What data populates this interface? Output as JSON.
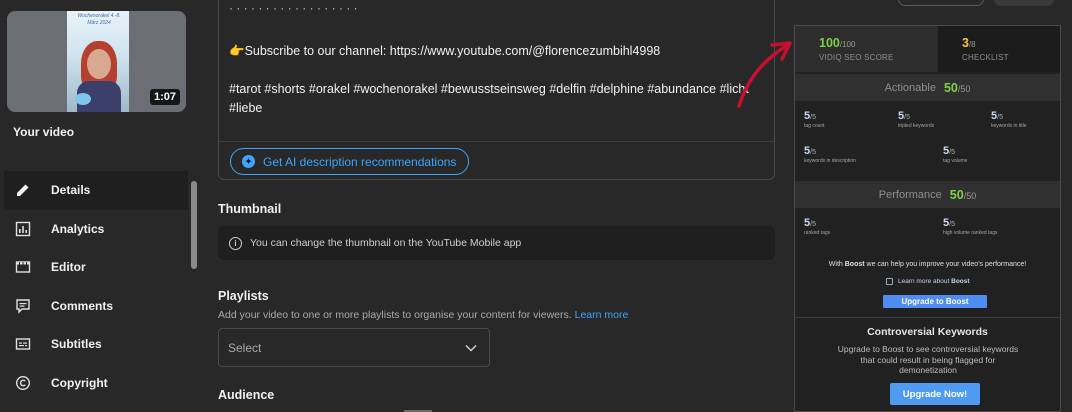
{
  "video": {
    "thumbnail_overlay_text": "Wochenorakel 4.-8. März 2024",
    "duration": "1:07",
    "label": "Your video"
  },
  "sidebar": {
    "items": [
      {
        "label": "Details",
        "icon": "pencil-icon",
        "active": true
      },
      {
        "label": "Analytics",
        "icon": "analytics-icon",
        "active": false
      },
      {
        "label": "Editor",
        "icon": "film-editor-icon",
        "active": false
      },
      {
        "label": "Comments",
        "icon": "comments-icon",
        "active": false
      },
      {
        "label": "Subtitles",
        "icon": "subtitles-icon",
        "active": false
      },
      {
        "label": "Copyright",
        "icon": "copyright-icon",
        "active": false
      }
    ]
  },
  "description": {
    "top_partial": "· · · · · · · · · · · · · · · · · ·",
    "subscribe_line": "👉Subscribe to our channel: https://www.youtube.com/@florencezumbihl4998",
    "hashtags_line1": "#tarot #shorts #orakel #wochenorakel #bewusstseinsweg #delfin #delphine #abundance #licht",
    "hashtags_line2": "#liebe",
    "ai_button": "Get AI description recommendations"
  },
  "thumbnail_section": {
    "title": "Thumbnail",
    "info": "You can change the thumbnail on the YouTube Mobile app"
  },
  "playlists": {
    "title": "Playlists",
    "subtitle": "Add your video to one or more playlists to organise your content for viewers.",
    "learn_more": "Learn more",
    "select_value": "Select"
  },
  "audience": {
    "title": "Audience"
  },
  "vidiq": {
    "seo_score": "100",
    "seo_total": "/100",
    "seo_label": "VIDIQ SEO SCORE",
    "checklist_score": "3",
    "checklist_total": "/8",
    "checklist_label": "CHECKLIST",
    "actionable_label": "Actionable",
    "actionable_score": "50",
    "actionable_total": "/50",
    "actionable_metrics": [
      {
        "value": "5",
        "total": "/5",
        "label": "tag count"
      },
      {
        "value": "5",
        "total": "/5",
        "label": "tripled keywords"
      },
      {
        "value": "5",
        "total": "/5",
        "label": "keywords in title"
      },
      {
        "value": "5",
        "total": "/5",
        "label": "keywords in description"
      },
      {
        "value": "5",
        "total": "/5",
        "label": "tag volume"
      }
    ],
    "performance_label": "Performance",
    "performance_score": "50",
    "performance_total": "/50",
    "performance_metrics": [
      {
        "value": "5",
        "total": "/5",
        "label": "ranked tags"
      },
      {
        "value": "5",
        "total": "/5",
        "label": "high volume ranked tags"
      }
    ],
    "boost_prefix": "With ",
    "boost_word": "Boost",
    "boost_suffix": " we can help you improve your video's performance!",
    "boost_link_prefix": "Learn more about ",
    "boost_link_word": "Boost",
    "boost_button": "Upgrade to Boost",
    "controversial_title": "Controversial Keywords",
    "controversial_text": "Upgrade to Boost to see controversial keywords that could result in being flagged for demonetization",
    "upgrade_now": "Upgrade Now!"
  },
  "colors": {
    "accent_blue": "#3ea6ff",
    "score_green": "#7bd148",
    "checklist_yellow": "#f2c744",
    "arrow_red": "#c8102e"
  }
}
